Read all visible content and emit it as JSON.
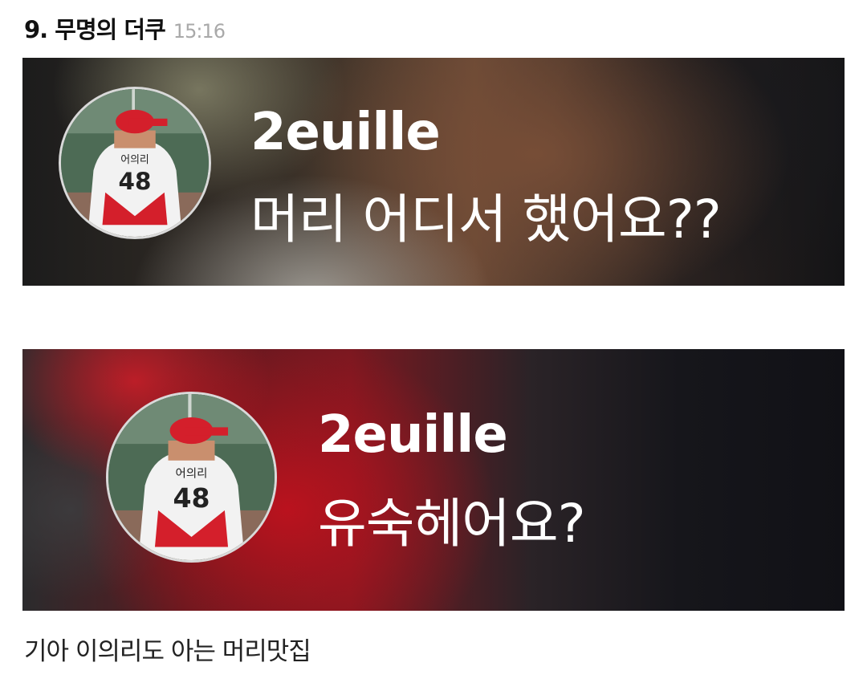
{
  "post": {
    "title": "9. 무명의 더쿠",
    "time": "15:16"
  },
  "comments": [
    {
      "username": "2euille",
      "message": "머리 어디서 했어요??",
      "avatar": {
        "jersey_text": "어의리",
        "jersey_number": "48"
      }
    },
    {
      "username": "2euille",
      "message": "유숙헤어요?",
      "avatar": {
        "jersey_text": "어의리",
        "jersey_number": "48"
      }
    }
  ],
  "caption": "기아 이의리도 아는 머리맛집",
  "colors": {
    "title_text": "#111111",
    "time_text": "#a9a9a9",
    "overlay_text": "#ffffff",
    "cap_red": "#d41f2b"
  }
}
